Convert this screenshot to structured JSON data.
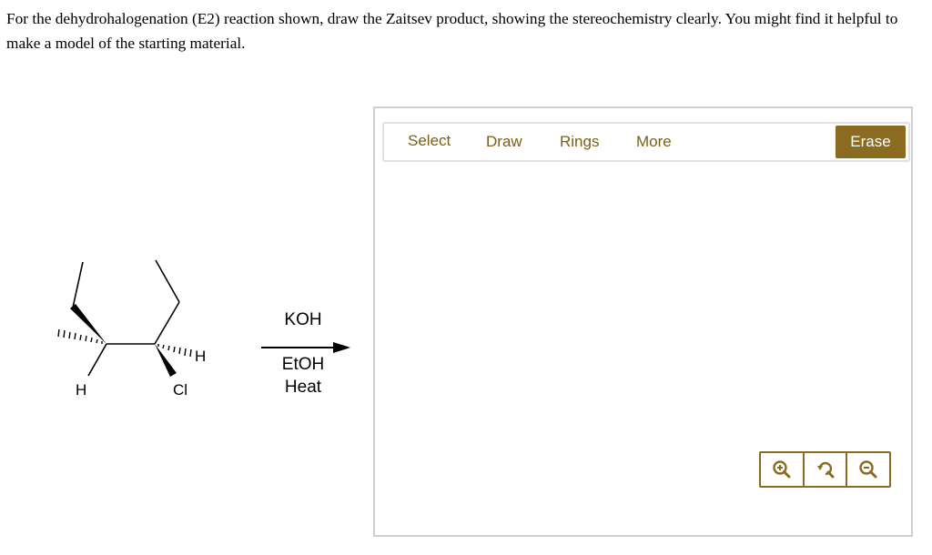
{
  "question": {
    "text": "For the dehydrohalogenation (E2) reaction shown, draw the Zaitsev product, showing the stereochemistry clearly. You might find it helpful to make a model of the starting material."
  },
  "molecule": {
    "labels": {
      "h_left": "H",
      "h_right": "H",
      "cl": "Cl"
    }
  },
  "reaction": {
    "reagent_top": "KOH",
    "reagent_bottom_1": "EtOH",
    "reagent_bottom_2": "Heat"
  },
  "editor": {
    "tools": {
      "select": "Select",
      "draw": "Draw",
      "rings": "Rings",
      "more": "More"
    },
    "erase_label": "Erase",
    "zoom_icons": [
      "zoom-in-icon",
      "reset-view-icon",
      "zoom-out-icon"
    ]
  },
  "colors": {
    "accent": "#8a6b1f",
    "tool_text": "#7b5f18",
    "frame_border": "#cfcfcf"
  }
}
